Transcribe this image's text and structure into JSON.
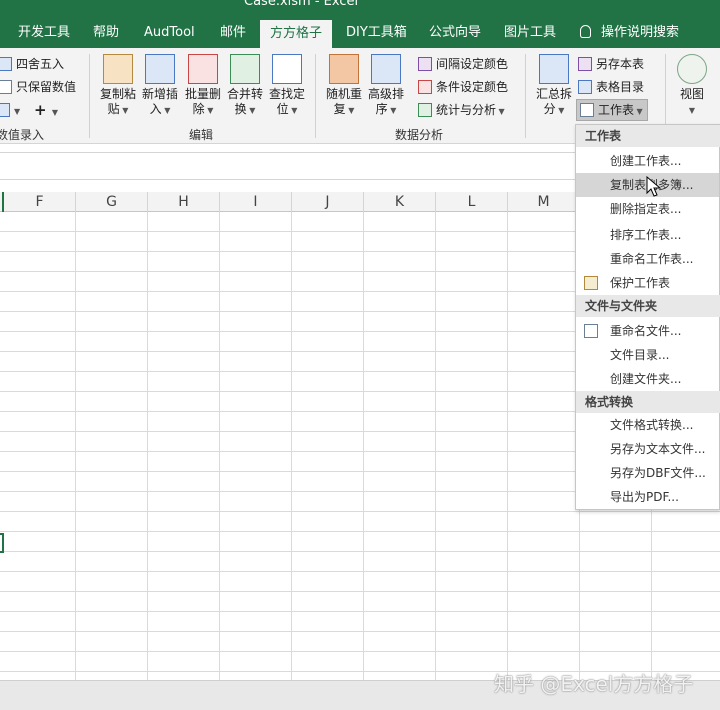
{
  "window": {
    "title": "Case.xlsm  -  Excel"
  },
  "tabs": [
    {
      "label": "开发工具",
      "active": false
    },
    {
      "label": "帮助",
      "active": false
    },
    {
      "label": "AudTool",
      "active": false
    },
    {
      "label": "邮件",
      "active": false
    },
    {
      "label": "方方格子",
      "active": true
    },
    {
      "label": "DIY工具箱",
      "active": false
    },
    {
      "label": "公式向导",
      "active": false
    },
    {
      "label": "图片工具",
      "active": false
    }
  ],
  "tell_me": {
    "label": "操作说明搜索",
    "icon": "lightbulb-icon"
  },
  "ribbon": {
    "group1": {
      "items": [
        {
          "label": "四舍五入",
          "icon": "round-icon"
        },
        {
          "label": "只保留数值",
          "icon": "keep-values-icon"
        },
        {
          "label": "",
          "icon": "edit-icon"
        },
        {
          "label": "+",
          "icon": "plus-icon"
        }
      ],
      "group_label": "数值录入"
    },
    "edit_group": {
      "buttons": [
        {
          "line1": "复制粘",
          "line2": "贴",
          "icon": "copy-paste-icon"
        },
        {
          "line1": "新增插",
          "line2": "入",
          "icon": "insert-icon"
        },
        {
          "line1": "批量删",
          "line2": "除",
          "icon": "batch-delete-icon"
        },
        {
          "line1": "合并转",
          "line2": "换",
          "icon": "merge-convert-icon"
        },
        {
          "line1": "查找定",
          "line2": "位",
          "icon": "find-locate-icon"
        }
      ],
      "group_label": "编辑"
    },
    "analysis_group": {
      "buttons": [
        {
          "line1": "随机重",
          "line2": "复",
          "icon": "random-dup-icon"
        },
        {
          "line1": "高级排",
          "line2": "序",
          "icon": "sort-icon"
        }
      ],
      "small": [
        {
          "label": "间隔设定颜色",
          "icon": "interval-color-icon"
        },
        {
          "label": "条件设定颜色",
          "icon": "condition-color-icon"
        },
        {
          "label": "统计与分析",
          "icon": "stats-icon"
        }
      ],
      "group_label": "数据分析"
    },
    "summary_button": {
      "line1": "汇总拆",
      "line2": "分",
      "icon": "summary-split-icon"
    },
    "sheet_small": [
      {
        "label": "另存本表",
        "icon": "save-sheet-icon"
      },
      {
        "label": "表格目录",
        "icon": "sheet-index-icon"
      },
      {
        "label": "工作表",
        "icon": "worksheet-icon"
      }
    ],
    "view_button": {
      "label": "视图",
      "icon": "view-icon"
    }
  },
  "grid": {
    "columns": [
      "F",
      "G",
      "H",
      "I",
      "J",
      "K",
      "L",
      "M"
    ]
  },
  "menu": {
    "sections": [
      {
        "header": "工作表",
        "items": [
          {
            "label": "创建工作表...",
            "icon": ""
          },
          {
            "label": "复制表到多簿...",
            "icon": "",
            "hover": true
          },
          {
            "label": "删除指定表...",
            "icon": ""
          },
          {
            "label": "排序工作表...",
            "icon": ""
          },
          {
            "label": "重命名工作表...",
            "icon": ""
          },
          {
            "label": "保护工作表",
            "icon": "protect-sheet-icon"
          }
        ]
      },
      {
        "header": "文件与文件夹",
        "items": [
          {
            "label": "重命名文件...",
            "icon": "rename-file-icon"
          },
          {
            "label": "文件目录...",
            "icon": ""
          },
          {
            "label": "创建文件夹...",
            "icon": ""
          }
        ]
      },
      {
        "header": "格式转换",
        "items": [
          {
            "label": "文件格式转换...",
            "icon": ""
          },
          {
            "label": "另存为文本文件...",
            "icon": ""
          },
          {
            "label": "另存为DBF文件...",
            "icon": ""
          },
          {
            "label": "导出为PDF...",
            "icon": ""
          }
        ]
      }
    ]
  },
  "watermark": "知乎 @Excel方方格子",
  "colors": {
    "excel_green": "#217346",
    "ribbon_bg": "#f3f3f3"
  }
}
